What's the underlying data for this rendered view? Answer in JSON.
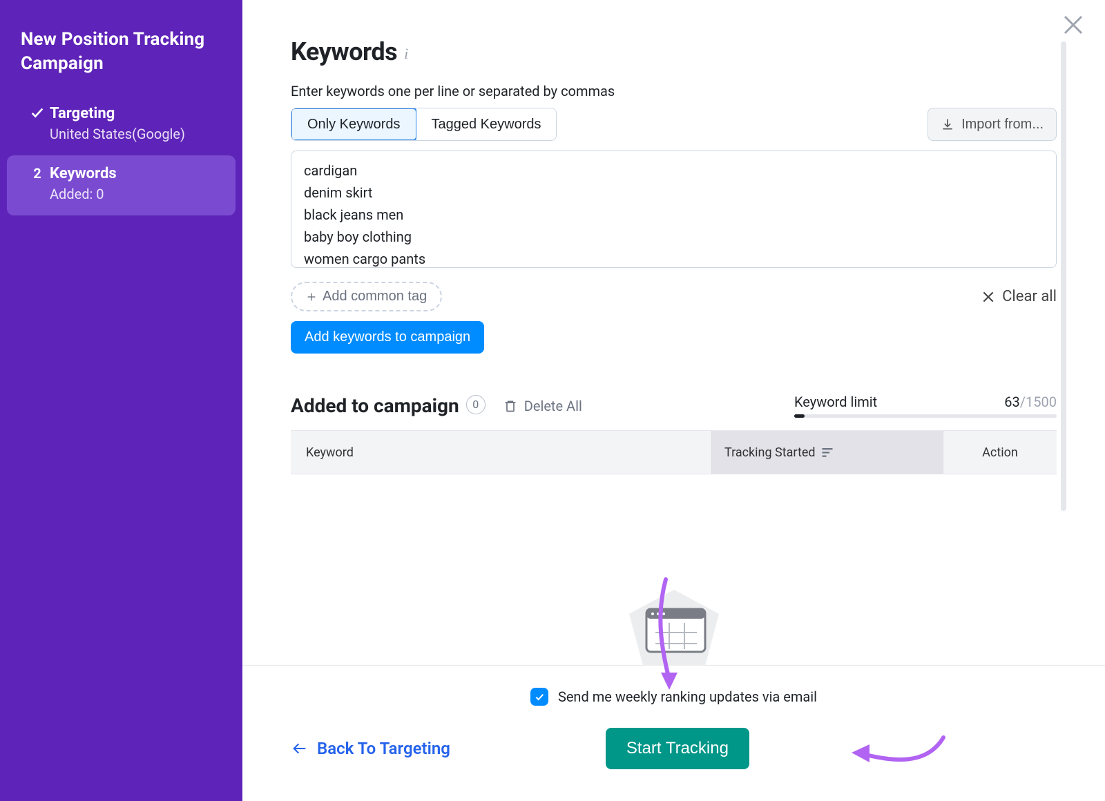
{
  "sidebar": {
    "title": "New Position Tracking Campaign",
    "step1": {
      "label": "Targeting",
      "sub": "United States(Google)"
    },
    "step2": {
      "index": "2",
      "label": "Keywords",
      "sub": "Added: 0"
    }
  },
  "page": {
    "title": "Keywords",
    "hint": "Enter keywords one per line or separated by commas"
  },
  "tabs": {
    "only": "Only Keywords",
    "tagged": "Tagged Keywords"
  },
  "import_label": "Import from...",
  "keywords_text": "cardigan\ndenim skirt\nblack jeans men\nbaby boy clothing\nwomen cargo pants",
  "add_tag_label": "Add common tag",
  "clear_all_label": "Clear all",
  "add_to_campaign_label": "Add keywords to campaign",
  "added": {
    "title": "Added to campaign",
    "count": "0",
    "delete_all": "Delete All",
    "limit_label": "Keyword limit",
    "limit_used": "63",
    "limit_total": "/1500"
  },
  "table": {
    "col_keyword": "Keyword",
    "col_tracking": "Tracking Started",
    "col_action": "Action"
  },
  "footer": {
    "email_label": "Send me weekly ranking updates via email",
    "back_label": "Back To Targeting",
    "start_label": "Start Tracking"
  }
}
